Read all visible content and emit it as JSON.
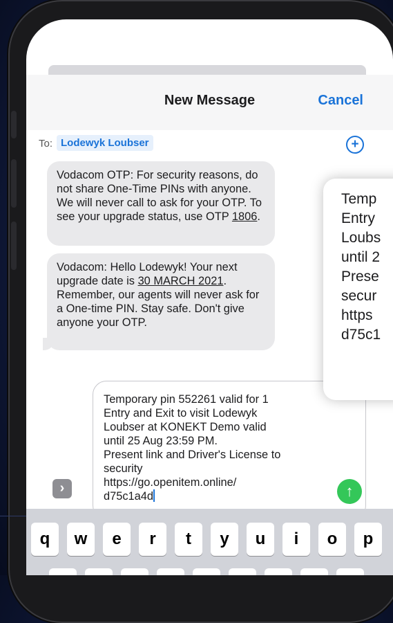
{
  "header": {
    "title": "New Message",
    "cancel_label": "Cancel"
  },
  "recipient": {
    "to_label": "To:",
    "name": "Lodewyk Loubser",
    "add_icon": "plus-circle-icon"
  },
  "messages": [
    {
      "text_before": "Vodacom OTP: For security reasons, do not share One-Time PINs with anyone. We will never call to ask for your OTP. To see your upgrade status, use OTP ",
      "underlined": "1806",
      "text_after": "."
    },
    {
      "text_before": "Vodacom: Hello Lodewyk! Your next upgrade date is ",
      "underlined": "30 MARCH 2021",
      "text_after": ". Remember, our agents will never ask for a One-time PIN. Stay safe. Don't give anyone your OTP."
    }
  ],
  "compose": {
    "text": "Temporary pin 552261 valid for 1\nEntry and Exit to visit Lodewyk\nLoubser at KONEKT Demo valid\nuntil 25 Aug 23:59 PM.\nPresent link and Driver's License to\nsecurity\nhttps://go.openitem.online/\nd75c1a4d",
    "send_icon": "arrow-up-icon",
    "apps_icon": "chevron-right-icon"
  },
  "keyboard": {
    "row1": [
      "q",
      "w",
      "e",
      "r",
      "t",
      "y",
      "u",
      "i",
      "o",
      "p"
    ]
  },
  "overlay_preview": {
    "lines": [
      "Temp",
      "Entry",
      "Loubs",
      "until 2",
      "Prese",
      "secur",
      "https",
      "d75c1"
    ]
  },
  "colors": {
    "accent": "#1a73d8",
    "send": "#34c759",
    "bubble": "#e9e9eb"
  }
}
